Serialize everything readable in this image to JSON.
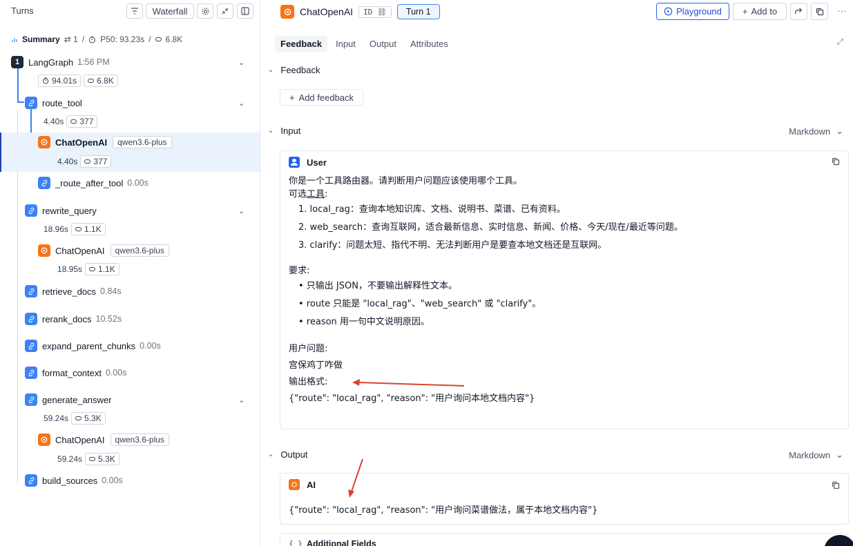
{
  "left": {
    "title": "Turns",
    "waterfall_label": "Waterfall",
    "summary": {
      "label": "Summary",
      "turns": "⇄ 1",
      "p50": "P50: 93.23s",
      "tokens": "6.8K"
    },
    "root": {
      "number": "1",
      "name": "LangGraph",
      "time": "1:56 PM",
      "latency": "94.01s",
      "tokens": "6.8K"
    },
    "nodes": {
      "route_tool": {
        "name": "route_tool",
        "latency": "4.40s",
        "tokens": "377"
      },
      "route_llm": {
        "name": "ChatOpenAI",
        "model": "qwen3.6-plus",
        "latency": "4.40s",
        "tokens": "377"
      },
      "route_after": {
        "name": "_route_after_tool",
        "latency": "0.00s"
      },
      "rewrite_query": {
        "name": "rewrite_query",
        "latency": "18.96s",
        "tokens": "1.1K"
      },
      "rewrite_llm": {
        "name": "ChatOpenAI",
        "model": "qwen3.6-plus",
        "latency": "18.95s",
        "tokens": "1.1K"
      },
      "retrieve_docs": {
        "name": "retrieve_docs",
        "latency": "0.84s"
      },
      "rerank_docs": {
        "name": "rerank_docs",
        "latency": "10.52s"
      },
      "expand_parent_chunks": {
        "name": "expand_parent_chunks",
        "latency": "0.00s"
      },
      "format_context": {
        "name": "format_context",
        "latency": "0.00s"
      },
      "generate_answer": {
        "name": "generate_answer",
        "latency": "59.24s",
        "tokens": "5.3K"
      },
      "generate_llm": {
        "name": "ChatOpenAI",
        "model": "qwen3.6-plus",
        "latency": "59.24s",
        "tokens": "5.3K"
      },
      "build_sources": {
        "name": "build_sources",
        "latency": "0.00s"
      }
    }
  },
  "header": {
    "title": "ChatOpenAI",
    "id_label": "ID",
    "turn_label": "Turn 1",
    "playground_label": "Playground",
    "add_to_label": "Add to"
  },
  "tabs": [
    "Feedback",
    "Input",
    "Output",
    "Attributes"
  ],
  "feedback": {
    "heading": "Feedback",
    "add_label": "Add feedback"
  },
  "input": {
    "heading": "Input",
    "format": "Markdown",
    "role": "User",
    "lines": {
      "l1": "你是一个工具路由器。请判断用户问题应该使用哪个工具。",
      "l2a": "可选",
      "l2b": "工具",
      "l2c": ":",
      "o1": "1. local_rag：查询本地知识库、文档、说明书、菜谱、已有资料。",
      "o2": "2. web_search：查询互联网，适合最新信息、实时信息、新闻、价格、今天/现在/最近等问题。",
      "o3": "3. clarify：问题太短、指代不明、无法判断用户是要查本地文档还是互联网。",
      "req": "要求:",
      "r1": "• 只输出 JSON，不要输出解释性文本。",
      "r2": "• route 只能是 \"local_rag\"、\"web_search\" 或 \"clarify\"。",
      "r3": "• reason 用一句中文说明原因。",
      "q_label": "用户问题:",
      "question": "宫保鸡丁咋做",
      "fmt_label": "输出格式:",
      "fmt": "{\"route\": \"local_rag\", \"reason\": \"用户询问本地文档内容\"}"
    }
  },
  "output": {
    "heading": "Output",
    "format": "Markdown",
    "role": "AI",
    "text": "{\"route\": \"local_rag\", \"reason\": \"用户询问菜谱做法，属于本地文档内容\"}",
    "additional_fields": "Additional Fields"
  },
  "colors": {
    "accent": "#2563eb",
    "chain": "#3b82f6",
    "llm": "#f97316",
    "annotation": "#d9432f"
  }
}
